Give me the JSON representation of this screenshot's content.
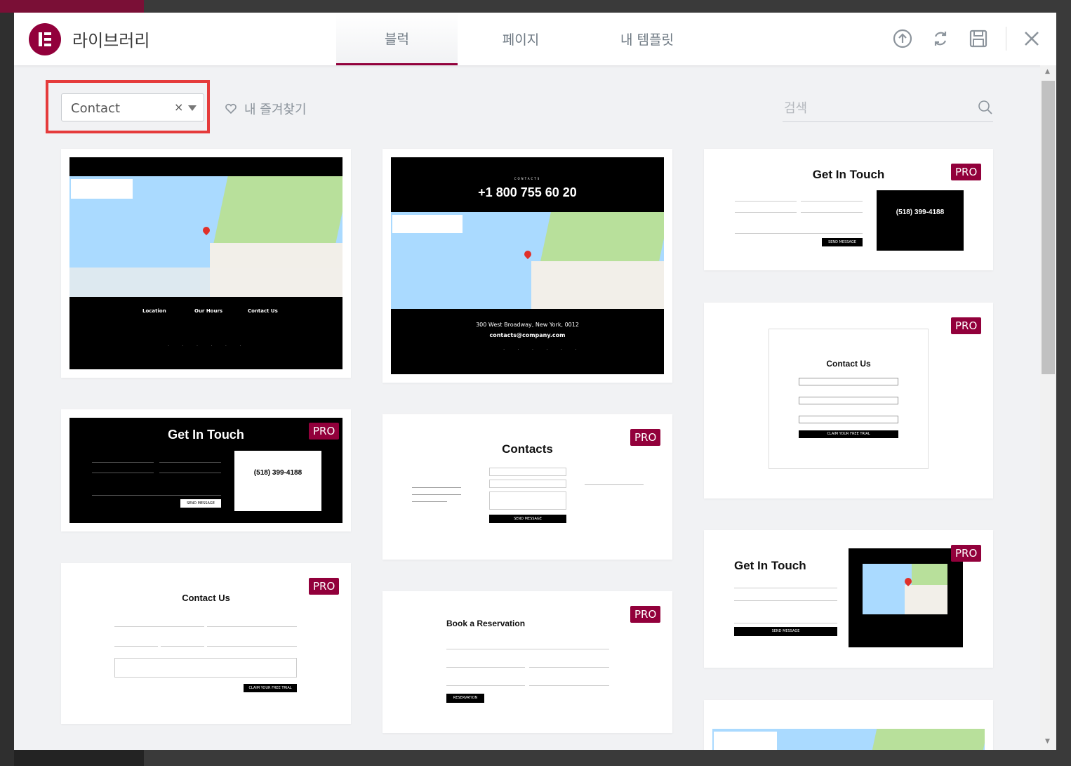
{
  "header": {
    "title": "라이브러리",
    "tabs": [
      {
        "label": "블럭",
        "active": true
      },
      {
        "label": "페이지",
        "active": false
      },
      {
        "label": "내 템플릿",
        "active": false
      }
    ],
    "icons": [
      "upload-icon",
      "sync-icon",
      "save-icon",
      "close-icon"
    ]
  },
  "toolbar": {
    "category_value": "Contact",
    "clear_symbol": "×",
    "favorites_label": "내 즐겨찾기",
    "search_placeholder": "검색"
  },
  "colors": {
    "brand": "#92003b",
    "highlight": "#e53b3b"
  },
  "cards": [
    {
      "pro": false,
      "labels": [
        "Location",
        "Our Hours",
        "Contact Us"
      ]
    },
    {
      "pro": false,
      "heading": "+1 800 755 60 20",
      "subheading": "CONTACTS",
      "address": "300 West Broadway, New York, 0012",
      "email": "contacts@company.com"
    },
    {
      "pro": true,
      "badge": "PRO",
      "heading": "Get In Touch",
      "phone": "(518) 399-4188",
      "button": "SEND MESSAGE"
    },
    {
      "pro": true,
      "badge": "PRO",
      "heading": "Get In Touch",
      "phone": "(518) 399-4188",
      "button": "SEND MESSAGE"
    },
    {
      "pro": true,
      "badge": "PRO",
      "heading": "Contacts",
      "button": "SEND MESSAGE"
    },
    {
      "pro": true,
      "badge": "PRO",
      "heading": "Contact Us",
      "button": "CLAIM YOUR FREE TRIAL"
    },
    {
      "pro": true,
      "badge": "PRO",
      "heading": "Contact Us",
      "button": "CLAIM YOUR FREE TRIAL"
    },
    {
      "pro": true,
      "badge": "PRO",
      "heading": "Book a Reservation",
      "button": "RESERVATION"
    },
    {
      "pro": true,
      "badge": "PRO",
      "heading": "Get In Touch",
      "button": "SEND MESSAGE"
    },
    {
      "pro": false
    }
  ]
}
